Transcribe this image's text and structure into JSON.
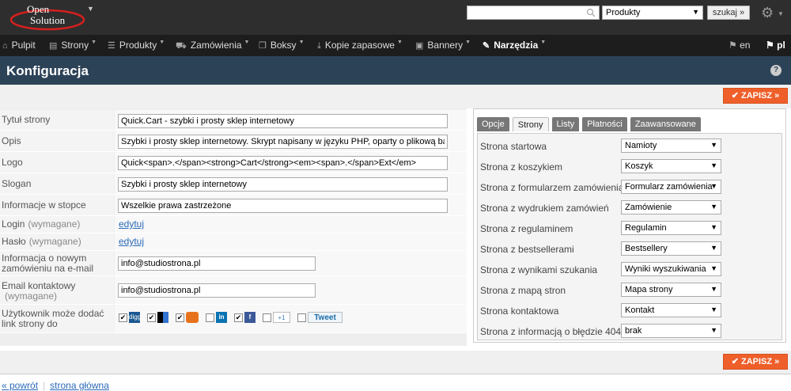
{
  "header": {
    "logo_text_top": "Open",
    "logo_text_bottom": "Solution",
    "search_value": "",
    "search_category": "Produkty",
    "search_button": "szukaj »"
  },
  "nav": {
    "items": [
      {
        "label": "Pulpit",
        "icon": "home-icon",
        "has_dropdown": false
      },
      {
        "label": "Strony",
        "icon": "document-icon",
        "has_dropdown": true
      },
      {
        "label": "Produkty",
        "icon": "list-icon",
        "has_dropdown": true
      },
      {
        "label": "Zamówienia",
        "icon": "cart-icon",
        "has_dropdown": true
      },
      {
        "label": "Boksy",
        "icon": "box-icon",
        "has_dropdown": true
      },
      {
        "label": "Kopie zapasowe",
        "icon": "download-icon",
        "has_dropdown": true
      },
      {
        "label": "Bannery",
        "icon": "image-icon",
        "has_dropdown": true
      },
      {
        "label": "Narzędzia",
        "icon": "wrench-icon",
        "has_dropdown": true,
        "active": true
      }
    ],
    "lang_en": "en",
    "lang_pl": "pl"
  },
  "page": {
    "title": "Konfiguracja",
    "save_label": "ZAPISZ »"
  },
  "form": {
    "title_label": "Tytuł strony",
    "title_value": "Quick.Cart - szybki i prosty sklep internetowy",
    "desc_label": "Opis",
    "desc_value": "Szybki i prosty sklep internetowy. Skrypt napisany w języku PHP, oparty o plikową bazę",
    "logo_label": "Logo",
    "logo_value": "Quick<span>.</span><strong>Cart</strong><em><span>.</span>Ext</em>",
    "slogan_label": "Slogan",
    "slogan_value": "Szybki i prosty sklep internetowy",
    "footer_label": "Informacje w stopce",
    "footer_value": "Wszelkie prawa zastrzeżone",
    "login_label": "Login",
    "required": "(wymagane)",
    "login_link": "edytuj",
    "pass_label": "Hasło",
    "pass_link": "edytuj",
    "notify_label": "Informacja o nowym zamówieniu na e-mail",
    "notify_value": "info@studiostrona.pl",
    "contact_label": "Email kontaktowy",
    "contact_value": "info@studiostrona.pl",
    "share_label": "Użytkownik może dodać link strony do",
    "share_tweet": "Tweet",
    "share_plus": "+1",
    "share_digg": "digg"
  },
  "tabs": [
    "Opcje",
    "Strony",
    "Listy",
    "Płatności",
    "Zaawansowane"
  ],
  "pages_settings": [
    {
      "label": "Strona startowa",
      "value": "Namioty"
    },
    {
      "label": "Strona z koszykiem",
      "value": "Koszyk"
    },
    {
      "label": "Strona z formularzem zamówienia",
      "value": "Formularz zamówienia"
    },
    {
      "label": "Strona z wydrukiem zamówień",
      "value": "Zamówienie"
    },
    {
      "label": "Strona z regulaminem",
      "value": "Regulamin"
    },
    {
      "label": "Strona z bestsellerami",
      "value": "Bestsellery"
    },
    {
      "label": "Strona z wynikami szukania",
      "value": "Wyniki wyszukiwania"
    },
    {
      "label": "Strona z mapą stron",
      "value": "Mapa strony"
    },
    {
      "label": "Strona kontaktowa",
      "value": "Kontakt"
    },
    {
      "label": "Strona z informacją o błędzie 404",
      "value": "brak"
    }
  ],
  "footer": {
    "back": "« powrót",
    "home": "strona główna"
  },
  "colors": {
    "accent": "#ee5f2a",
    "title_bar": "#2c4257",
    "link": "#2a6ab8"
  }
}
